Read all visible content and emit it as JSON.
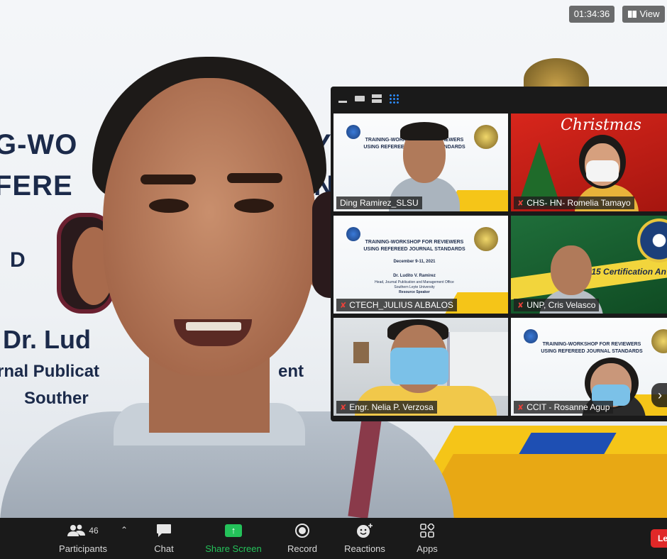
{
  "meeting": {
    "timer": "01:34:36",
    "view_label": "View"
  },
  "slide": {
    "line1": "G-WO",
    "line1_right": "YI",
    "line2": "FERE",
    "line2_right": "N",
    "line3": "D",
    "line4": "Dr. Lud",
    "line5": "rnal Publicat",
    "line5_right": "ent",
    "line6": "Souther"
  },
  "gallery": {
    "tiles": [
      {
        "name": "Ding Ramirez_SLSU",
        "muted": false
      },
      {
        "name": "CHS- HN- Romelia Tamayo",
        "muted": true
      },
      {
        "name": "CTECH_JULIUS ALBALOS",
        "muted": true
      },
      {
        "name": "UNP, Cris Velasco",
        "muted": true
      },
      {
        "name": "Engr. Nelia P. Verzosa",
        "muted": true
      },
      {
        "name": "CCIT - Rosanne Agup",
        "muted": true
      }
    ],
    "slide_title_1": "TRAINING-WORKSHOP FOR REVIEWERS",
    "slide_title_2": "USING REFEREED JOURNAL STANDARDS",
    "slide_date": "December 9-11, 2021",
    "slide_speaker": "Dr. Ludito V. Ramirez",
    "slide_role": "Head, Journal Publication and Management Office",
    "slide_univ": "Southern Leyte University",
    "slide_resource": "Resource Speaker",
    "xmas_text": "Christmas",
    "cert_text": "2015 Certification An"
  },
  "toolbar": {
    "participants_label": "Participants",
    "participants_count": "46",
    "chat_label": "Chat",
    "share_label": "Share Screen",
    "record_label": "Record",
    "reactions_label": "Reactions",
    "apps_label": "Apps",
    "leave_label": "Le"
  },
  "colors": {
    "share_green": "#24c25a",
    "active_speaker": "#c6e06a",
    "leave_red": "#e02828",
    "gallery_blue": "#2d8cff"
  }
}
